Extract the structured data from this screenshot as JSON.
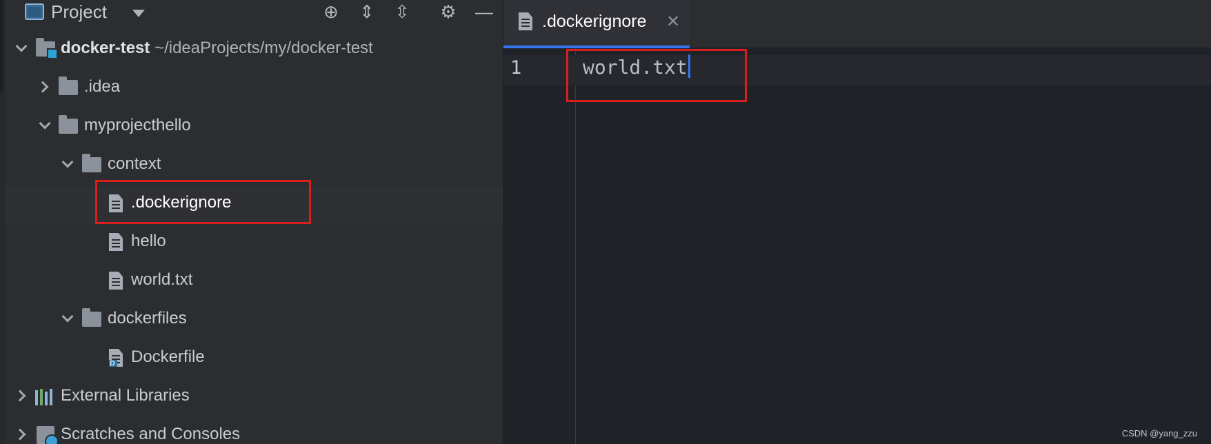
{
  "project_panel": {
    "title": "Project",
    "tree": {
      "root": {
        "name": "docker-test",
        "path": "~/ideaProjects/my/docker-test"
      },
      "idea": ".idea",
      "myprojecthello": "myprojecthello",
      "context": "context",
      "dockerignore": ".dockerignore",
      "hello": "hello",
      "world": "world.txt",
      "dockerfiles": "dockerfiles",
      "dockerfile": "Dockerfile",
      "external_libraries": "External Libraries",
      "scratches": "Scratches and Consoles"
    }
  },
  "editor": {
    "tab_label": ".dockerignore",
    "line_number": "1",
    "line_text": "world.txt"
  },
  "watermark": "CSDN @yang_zzu",
  "colors": {
    "highlight": "#d91e1e",
    "accent": "#3574f0"
  },
  "icons": [
    "project-view-icon",
    "dropdown-caret-icon",
    "locate-icon",
    "expand-all-icon",
    "collapse-all-icon",
    "settings-gear-icon",
    "hide-panel-icon",
    "folder-icon",
    "text-file-icon",
    "dockerfile-icon",
    "libraries-icon",
    "scratches-icon",
    "close-icon"
  ]
}
